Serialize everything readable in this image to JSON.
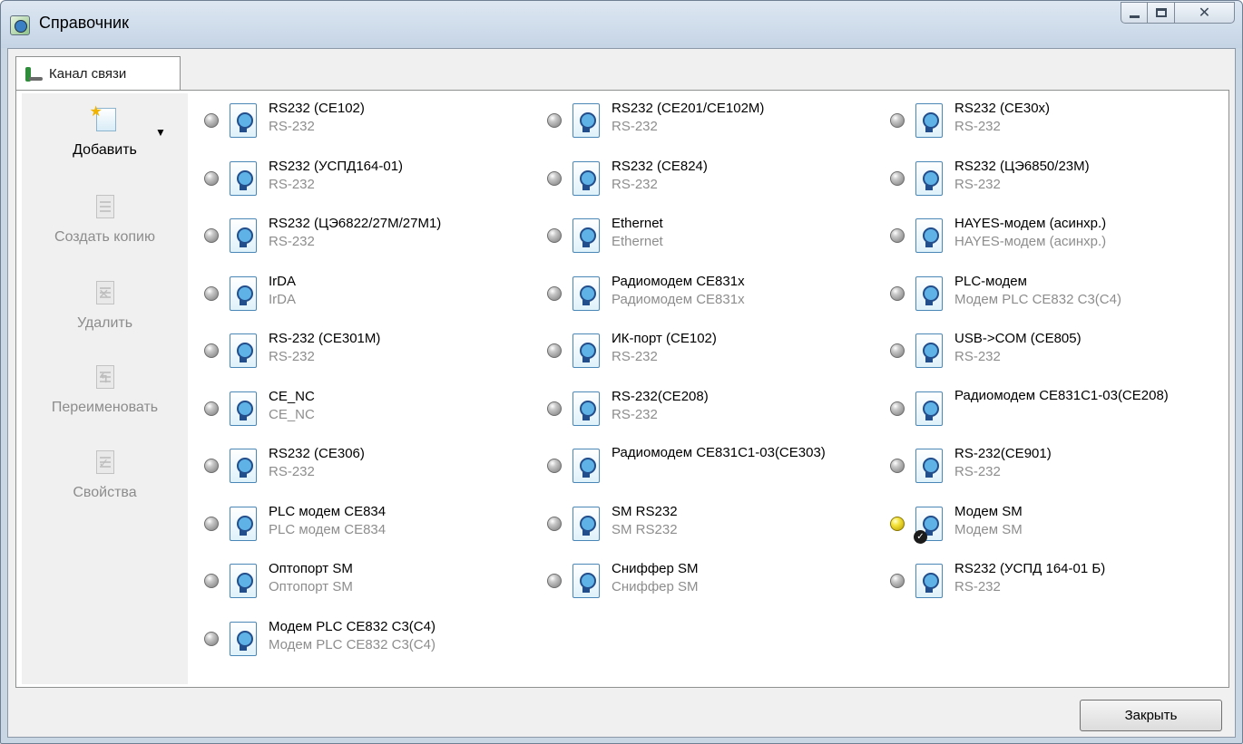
{
  "window": {
    "title": "Справочник"
  },
  "tab": {
    "label": "Канал связи"
  },
  "actions": {
    "add": "Добавить",
    "copy": "Создать копию",
    "delete": "Удалить",
    "rename": "Переименовать",
    "properties": "Свойства"
  },
  "items": [
    {
      "name": "RS232 (CE102)",
      "sub": "RS-232",
      "active": false
    },
    {
      "name": "RS232 (CE201/CE102M)",
      "sub": "RS-232",
      "active": false
    },
    {
      "name": "RS232 (CE30x)",
      "sub": "RS-232",
      "active": false
    },
    {
      "name": "RS232 (УСПД164-01)",
      "sub": "RS-232",
      "active": false
    },
    {
      "name": "RS232 (CE824)",
      "sub": "RS-232",
      "active": false
    },
    {
      "name": "RS232 (ЦЭ6850/23М)",
      "sub": "RS-232",
      "active": false
    },
    {
      "name": "RS232 (ЦЭ6822/27М/27М1)",
      "sub": "RS-232",
      "active": false
    },
    {
      "name": "Ethernet",
      "sub": "Ethernet",
      "active": false
    },
    {
      "name": "HAYES-модем (асинхр.)",
      "sub": "HAYES-модем (асинхр.)",
      "active": false
    },
    {
      "name": "IrDA",
      "sub": "IrDA",
      "active": false
    },
    {
      "name": "Радиомодем CE831x",
      "sub": "Радиомодем CE831x",
      "active": false
    },
    {
      "name": "PLC-модем",
      "sub": "Модем PLC CE832 C3(C4)",
      "active": false
    },
    {
      "name": "RS-232 (CE301M)",
      "sub": "RS-232",
      "active": false
    },
    {
      "name": "ИК-порт (CE102)",
      "sub": "RS-232",
      "active": false
    },
    {
      "name": "USB->COM (CE805)",
      "sub": "RS-232",
      "active": false
    },
    {
      "name": "CE_NC",
      "sub": "CE_NC",
      "active": false
    },
    {
      "name": "RS-232(CE208)",
      "sub": "RS-232",
      "active": false
    },
    {
      "name": "Радиомодем CE831C1-03(CE208)",
      "sub": "",
      "active": false
    },
    {
      "name": "RS232 (CE306)",
      "sub": "RS-232",
      "active": false
    },
    {
      "name": "Радиомодем CE831C1-03(CE303)",
      "sub": "",
      "active": false
    },
    {
      "name": "RS-232(CE901)",
      "sub": "RS-232",
      "active": false
    },
    {
      "name": "PLC модем CE834",
      "sub": "PLC модем CE834",
      "active": false
    },
    {
      "name": "SM RS232",
      "sub": "SM RS232",
      "active": false
    },
    {
      "name": "Модем SM",
      "sub": "Модем SM",
      "active": true
    },
    {
      "name": "Оптопорт SM",
      "sub": "Оптопорт SM",
      "active": false
    },
    {
      "name": "Сниффер SM",
      "sub": "Сниффер SM",
      "active": false
    },
    {
      "name": "RS232 (УСПД 164-01 Б)",
      "sub": "RS-232",
      "active": false
    },
    {
      "name": "Модем PLC CE832 C3(C4)",
      "sub": "Модем PLC CE832 C3(C4)",
      "active": false
    }
  ],
  "footer": {
    "close_label": "Закрыть"
  }
}
